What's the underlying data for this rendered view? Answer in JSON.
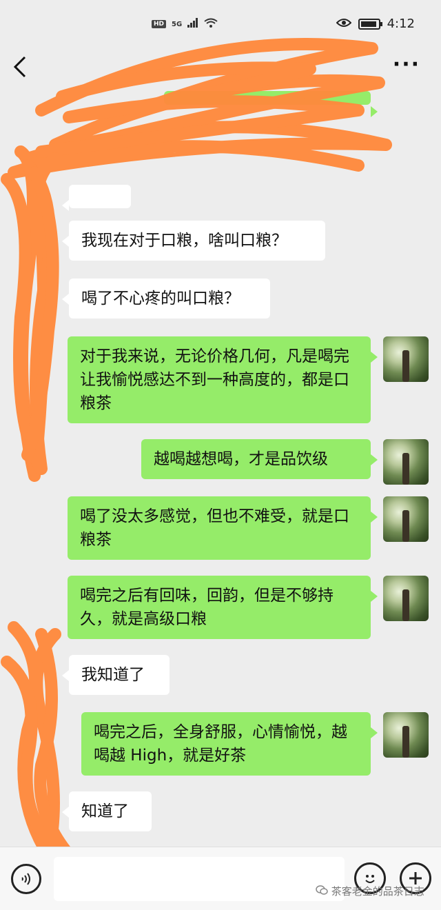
{
  "status_bar": {
    "hd": "HD",
    "net": "5G",
    "time": "4:12"
  },
  "nav": {
    "back": "<",
    "title": "",
    "more": "···"
  },
  "messages": [
    {
      "side": "in",
      "text": "我现在对于口粮，啥叫口粮？"
    },
    {
      "side": "in",
      "text": "喝了不心疼的叫口粮？"
    },
    {
      "side": "out",
      "text": "对于我来说，无论价格几何，凡是喝完让我愉悦感达不到一种高度的，都是口粮茶"
    },
    {
      "side": "out",
      "text": "越喝越想喝，才是品饮级"
    },
    {
      "side": "out",
      "text": "喝了没太多感觉，但也不难受，就是口粮茶"
    },
    {
      "side": "out",
      "text": "喝完之后有回味，回韵，但是不够持久，就是高级口粮"
    },
    {
      "side": "in",
      "text": "我知道了"
    },
    {
      "side": "out",
      "text": "喝完之后，全身舒服，心情愉悦，越喝越 High，就是好茶"
    },
    {
      "side": "in",
      "text": "知道了"
    }
  ],
  "input_bar": {
    "voice_icon": "voice-icon",
    "emoji_icon": "emoji-icon",
    "plus_icon": "plus-icon"
  },
  "watermark": "茶客老金的品茶日志",
  "colors": {
    "incoming_bubble": "#ffffff",
    "outgoing_bubble": "#95ec69",
    "background": "#ededed",
    "scribble": "#ff8a3d"
  }
}
